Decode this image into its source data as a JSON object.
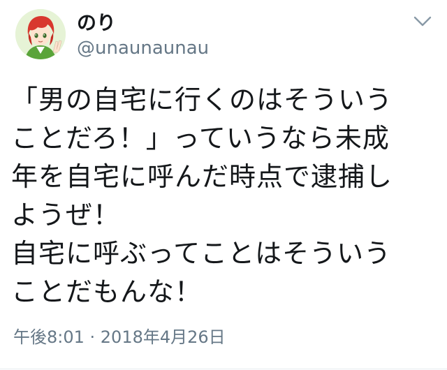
{
  "tweet": {
    "author": {
      "display_name": "のり",
      "handle": "@unaunaunau",
      "avatar_icon": "anime-avatar-icon"
    },
    "menu_icon": "chevron-down-icon",
    "text_lines": [
      "「男の自宅に行くのはそういう",
      "ことだろ！」っていうなら未成",
      "年を自宅に呼んだ時点で逮捕し",
      "ようぜ！",
      "自宅に呼ぶってことはそういう",
      "ことだもんな！"
    ],
    "timestamp": "午後8:01 · 2018年4月26日"
  },
  "colors": {
    "text_primary": "#14171a",
    "text_secondary": "#657786",
    "chevron": "#8899a6",
    "divider": "#e6ecf0"
  }
}
